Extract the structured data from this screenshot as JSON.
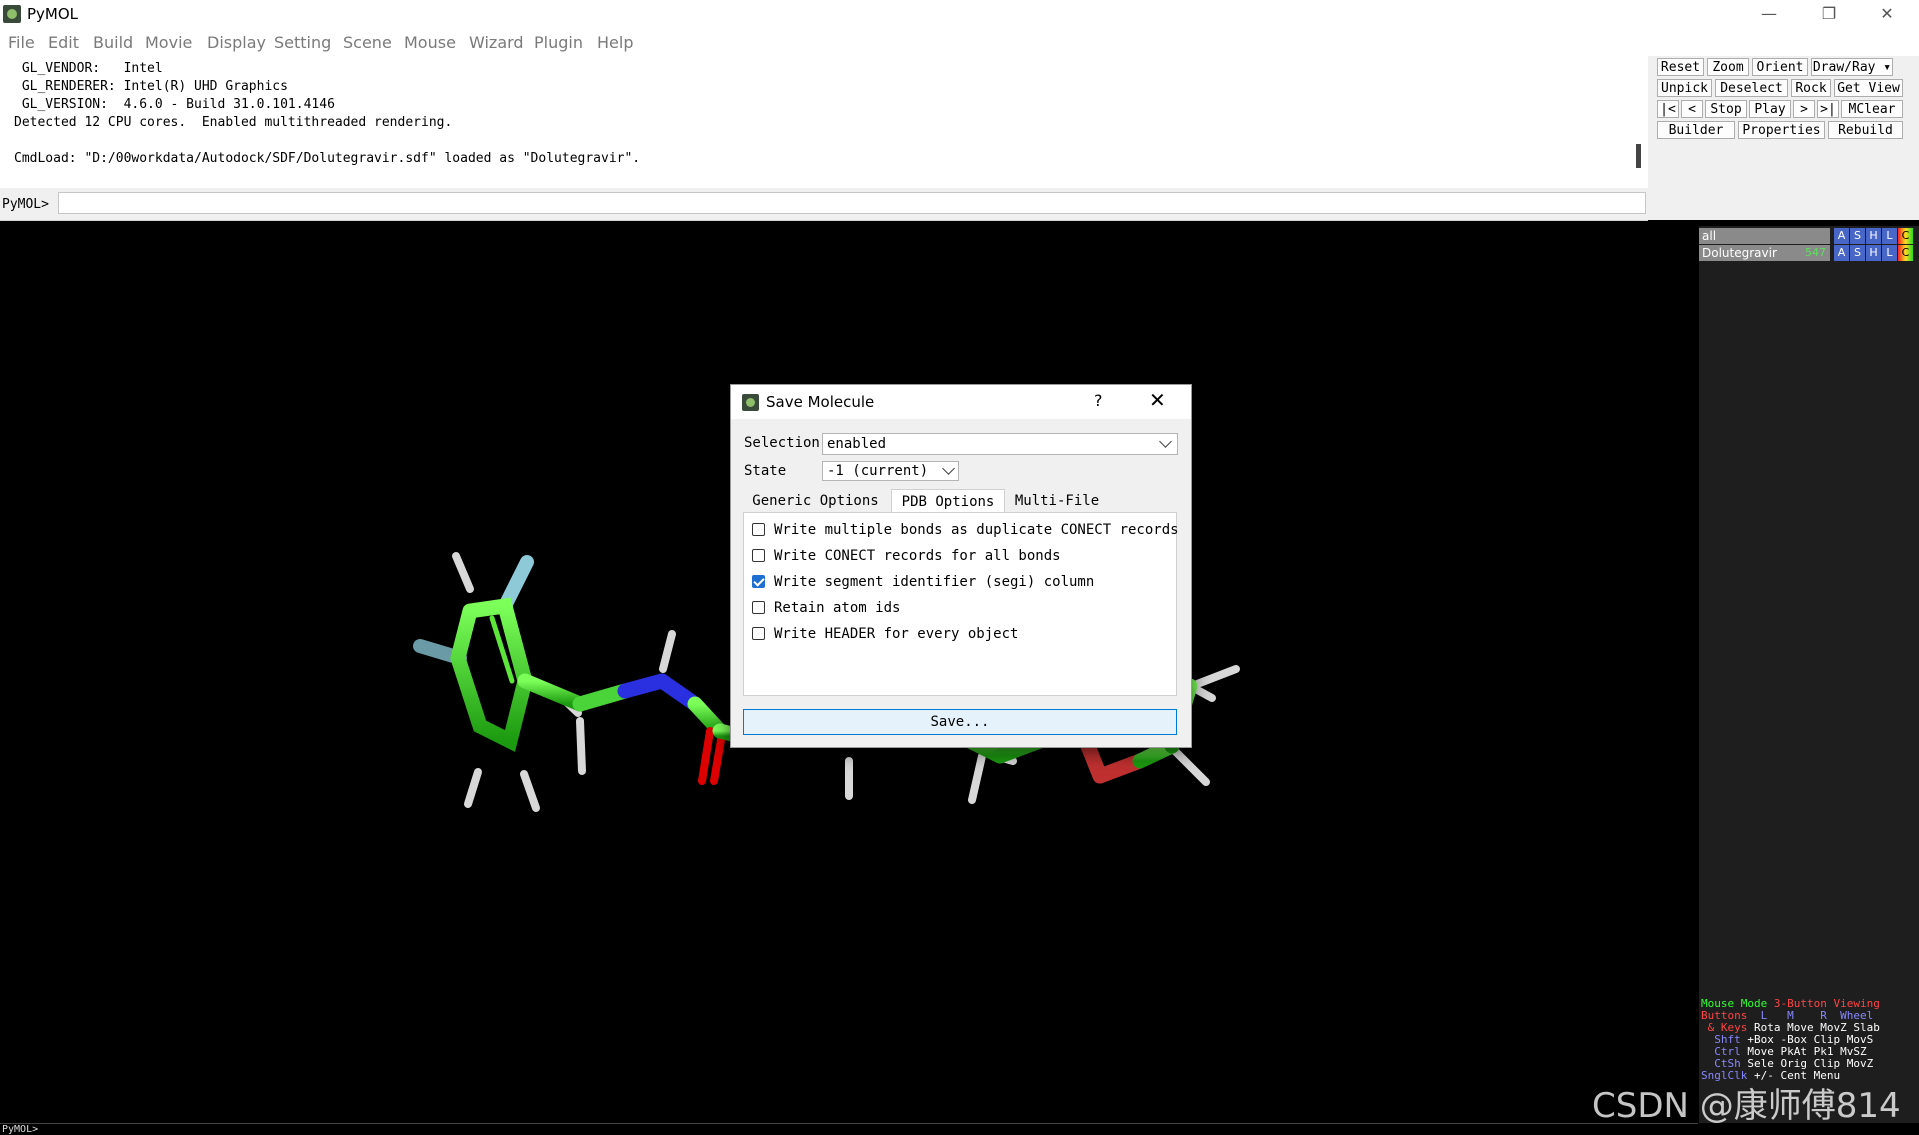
{
  "window": {
    "title": "PyMOL",
    "minimize": "—",
    "maximize": "❐",
    "close": "✕"
  },
  "menu": [
    "File",
    "Edit",
    "Build",
    "Movie",
    "Display",
    "Setting",
    "Scene",
    "Mouse",
    "Wizard",
    "Plugin",
    "Help"
  ],
  "console": {
    "lines": [
      " GL_VENDOR:   Intel",
      " GL_RENDERER: Intel(R) UHD Graphics",
      " GL_VERSION:  4.6.0 - Build 31.0.101.4146",
      "Detected 12 CPU cores.  Enabled multithreaded rendering.",
      "",
      "CmdLoad: \"D:/00workdata/Autodock/SDF/Dolutegravir.sdf\" loaded as \"Dolutegravir\"."
    ]
  },
  "cmdline": {
    "label": "PyMOL>",
    "value": ""
  },
  "buttons": {
    "reset": "Reset",
    "zoom": "Zoom",
    "orient": "Orient",
    "draw_ray": "Draw/Ray ▾",
    "unpick": "Unpick",
    "deselect": "Deselect",
    "rock": "Rock",
    "get_view": "Get View",
    "first": "|<",
    "prev": "<",
    "stop": "Stop",
    "play": "Play",
    "next": ">",
    "last": ">|",
    "mclear": "MClear",
    "builder": "Builder",
    "properties": "Properties",
    "rebuild": "Rebuild"
  },
  "objects": [
    {
      "name": "all",
      "count": "",
      "btns": [
        "A",
        "S",
        "H",
        "L",
        "C"
      ]
    },
    {
      "name": "Dolutegravir",
      "count": "547",
      "btns": [
        "A",
        "S",
        "H",
        "L",
        "C"
      ]
    }
  ],
  "mouse_help": {
    "line1": [
      "Mouse Mode",
      "3-Button Viewing"
    ],
    "line2": [
      "Buttons",
      "L",
      "M",
      "R",
      "Wheel"
    ],
    "line3": [
      "& Keys",
      "Rota Move MovZ Slab"
    ],
    "line4": [
      "Shft",
      "+Box -Box Clip MovS"
    ],
    "line5": [
      "Ctrl",
      "Move PkAt Pk1  MvSZ"
    ],
    "line6": [
      "CtSh",
      "Sele Orig Clip MovZ"
    ],
    "line7": [
      "SnglClk",
      "+/-  Cent Menu"
    ]
  },
  "bottom": {
    "label": "PyMOL>"
  },
  "watermark": "CSDN @康师傅814",
  "dialog": {
    "title": "Save Molecule",
    "help": "?",
    "close": "✕",
    "selection_label": "Selection",
    "selection_value": "enabled",
    "state_label": "State",
    "state_value": "-1 (current)",
    "tabs": [
      "Generic Options",
      "PDB Options",
      "Multi-File"
    ],
    "active_tab": "PDB Options",
    "options": [
      {
        "label": "Write multiple bonds as duplicate CONECT records",
        "checked": false
      },
      {
        "label": "Write CONECT records for all bonds",
        "checked": false
      },
      {
        "label": "Write segment identifier (segi) column",
        "checked": true
      },
      {
        "label": "Retain atom ids",
        "checked": false
      },
      {
        "label": "Write HEADER for every object",
        "checked": false
      }
    ],
    "save_label": "Save..."
  }
}
